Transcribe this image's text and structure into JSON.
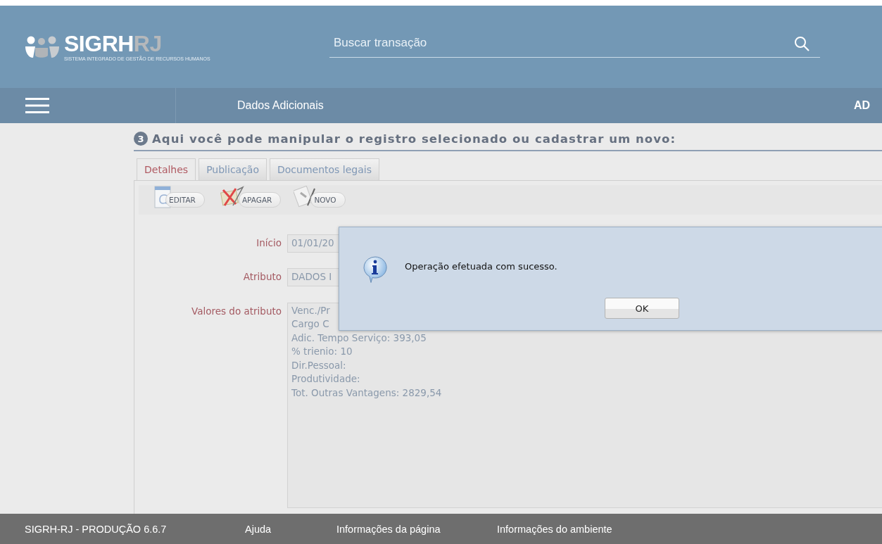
{
  "header": {
    "logo": {
      "main": "SIGRH",
      "suffix": "RJ",
      "tagline": "SISTEMA INTEGRADO DE GESTÃO DE RECURSOS HUMANOS"
    },
    "search": {
      "placeholder": "Buscar transação"
    }
  },
  "nav": {
    "title": "Dados Adicionais",
    "user": "AD"
  },
  "section": {
    "step": "3",
    "title": "Aqui você pode manipular o registro selecionado ou cadastrar um novo:"
  },
  "tabs": [
    {
      "label": "Detalhes",
      "selected": true
    },
    {
      "label": "Publicação",
      "selected": false
    },
    {
      "label": "Documentos legais",
      "selected": false
    }
  ],
  "toolbar": [
    {
      "kind": "edit",
      "label": "EDITAR"
    },
    {
      "kind": "delete",
      "label": "APAGAR"
    },
    {
      "kind": "new",
      "label": "NOVO"
    }
  ],
  "form": [
    {
      "kind": "input",
      "label": "Início",
      "value": "01/01/20"
    },
    {
      "kind": "input",
      "label": "Atributo",
      "value": "DADOS I"
    },
    {
      "kind": "textarea",
      "label": "Valores do atributo",
      "value": "Venc./Pr\nCargo C\nAdic. Tempo Serviço: 393,05\n% trienio: 10\nDir.Pessoal:\nProdutividade:\nTot. Outras Vantagens: 2829,54"
    }
  ],
  "dialog": {
    "message": "Operação efetuada com sucesso.",
    "button": "OK"
  },
  "footer": {
    "version": "SIGRH-RJ - PRODUÇÃO 6.6.7",
    "links": [
      "Ajuda",
      "Informações da página",
      "Informações do ambiente"
    ]
  }
}
